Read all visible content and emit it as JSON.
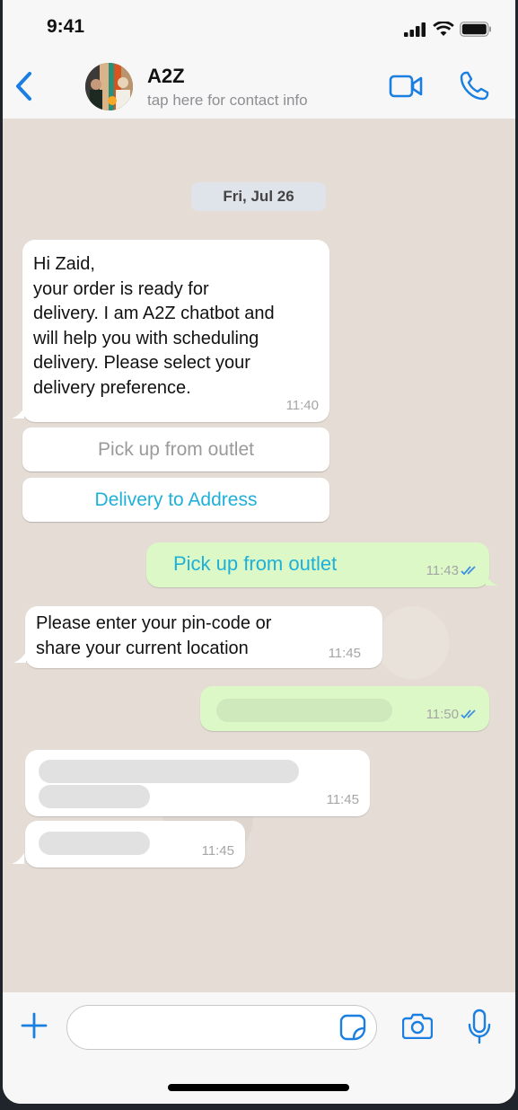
{
  "status_bar": {
    "time": "9:41",
    "icons": [
      "cellular-signal-icon",
      "wifi-icon",
      "battery-icon"
    ]
  },
  "header": {
    "back_icon": "chevron-left-icon",
    "contact_name": "A2Z",
    "contact_subtitle": "tap here for contact info",
    "actions": [
      "video-call-icon",
      "phone-call-icon"
    ]
  },
  "chat": {
    "date_chip": "Fri, Jul 26",
    "messages": [
      {
        "direction": "incoming",
        "text": "Hi Zaid,\nyour order is ready for\ndelivery. I am A2Z chatbot and\nwill help you with scheduling\ndelivery. Please select your\ndelivery preference.",
        "time": "11:40"
      },
      {
        "direction": "outgoing",
        "text": "Pick up from outlet",
        "time": "11:43",
        "status": "read"
      },
      {
        "direction": "incoming",
        "text": "Please enter your pin-code or\nshare your current location",
        "time": "11:45"
      },
      {
        "direction": "outgoing",
        "text": "",
        "time": "11:50",
        "status": "read",
        "placeholder": true
      },
      {
        "direction": "incoming",
        "text": "",
        "time": "11:45",
        "placeholder": true
      },
      {
        "direction": "incoming",
        "text": "",
        "time": "11:45",
        "placeholder": true
      }
    ],
    "quick_replies": [
      {
        "label": "Pick up from outlet",
        "state": "disabled"
      },
      {
        "label": "Delivery to Address",
        "state": "active"
      }
    ]
  },
  "input_bar": {
    "message_value": "",
    "icons": [
      "plus-icon",
      "sticker-icon",
      "camera-icon",
      "microphone-icon"
    ]
  },
  "colors": {
    "accent": "#1a7fe0",
    "quick_reply_active": "#1fb0d8",
    "quick_reply_disabled": "#9a9a9a",
    "outgoing_bubble": "#dcf8c6",
    "incoming_bubble": "#ffffff",
    "chat_background": "#e5ddd5",
    "read_ticks": "#3d8fe0"
  }
}
